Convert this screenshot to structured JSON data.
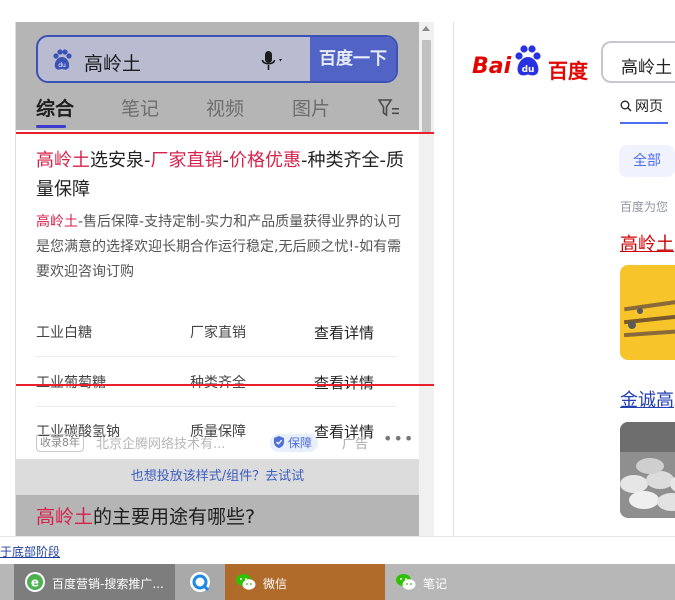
{
  "mobile": {
    "search": {
      "query": "高岭土",
      "button": "百度一下"
    },
    "tabs": [
      "综合",
      "笔记",
      "视频",
      "图片"
    ],
    "ad": {
      "title_parts": [
        {
          "text": "高岭土",
          "highlight": true
        },
        {
          "text": "选安泉-",
          "highlight": false
        },
        {
          "text": "厂家直销",
          "highlight": true
        },
        {
          "text": "-",
          "highlight": false
        },
        {
          "text": "价格优惠",
          "highlight": true
        },
        {
          "text": "-种类齐全-质量保障",
          "highlight": false
        }
      ],
      "desc_highlight": "高岭土",
      "desc_rest": "-售后保障-支持定制-实力和产品质量获得业界的认可是您满意的选择欢迎长期合作运行稳定,无后顾之忧!-如有需要欢迎咨询订购",
      "services": [
        {
          "product": "工业白糖",
          "feature": "厂家直销",
          "action": "查看详情"
        },
        {
          "product": "工业葡萄糖",
          "feature": "种类齐全",
          "action": "查看详情"
        },
        {
          "product": "工业碳酸氢钠",
          "feature": "质量保障",
          "action": "查看详情"
        }
      ],
      "badge": "收录8年",
      "company": "北京企腾网络技术有...",
      "guarantee": "保障",
      "ad_label": "广告",
      "more": "•••"
    },
    "try_prompt": "也想投放该样式/组件？去试试",
    "next_result": {
      "highlight": "高岭土",
      "rest": "的主要用途有哪些?"
    }
  },
  "desktop": {
    "logo": {
      "latin": "Bai",
      "paw_text": "du",
      "chinese": "百度"
    },
    "query": "高岭土",
    "tab": "网页",
    "all_button": "全部",
    "note": "百度为您",
    "result1": "高岭土",
    "result2": "金诚高"
  },
  "status_text": "于底部阶段",
  "taskbar": {
    "items": [
      "百度营销-搜索推广...",
      "",
      "微信",
      "笔记"
    ]
  },
  "colors": {
    "accent": "#3a52b6",
    "highlight": "#d6224a",
    "frame": "#e9202b",
    "baidu_red": "#e10601"
  }
}
